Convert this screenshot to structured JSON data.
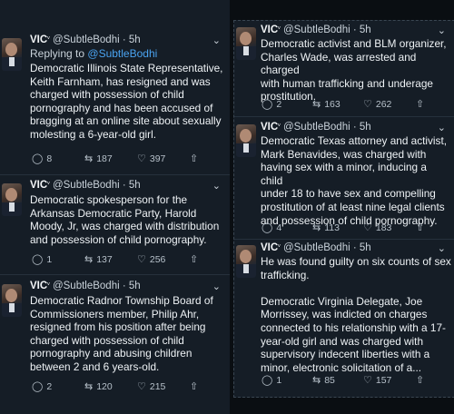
{
  "common": {
    "display_name": "VIC",
    "verified_mark": "ᵛ",
    "handle": "@SubtleBodhi",
    "time": "5h",
    "chevron": "⌄",
    "icons": {
      "reply": "◯",
      "retweet": "⇆",
      "like": "♡",
      "share": "⇧"
    }
  },
  "left_tweets": [
    {
      "reply_to_prefix": "Replying to",
      "reply_to_handle": "@SubtleBodhi",
      "text": "Democratic Illinois State Representative,\nKeith Farnham, has resigned and was\ncharged with possession of child\npornography and has been accused of\nbragging at an online site about sexually\nmolesting a 6-year-old girl.",
      "replies": "8",
      "retweets": "187",
      "likes": "397"
    },
    {
      "text": "Democratic spokesperson for the\nArkansas Democratic Party, Harold\nMoody, Jr, was charged with distribution\nand possession of child pornography.",
      "replies": "1",
      "retweets": "137",
      "likes": "256"
    },
    {
      "text": "Democratic Radnor Township Board of\nCommissioners member, Philip Ahr,\nresigned from his position after being\ncharged with possession of child\npornography and abusing children\nbetween 2 and 6 years-old.",
      "replies": "2",
      "retweets": "120",
      "likes": "215"
    }
  ],
  "right_tweets": [
    {
      "text": "Democratic activist and BLM organizer,\nCharles Wade, was arrested and charged\nwith human trafficking and underage\nprostitution.",
      "replies": "2",
      "retweets": "163",
      "likes": "262"
    },
    {
      "text": "Democratic Texas attorney and activist,\nMark Benavides, was charged with\nhaving sex with a minor, inducing a child\nunder 18 to have sex and compelling\nprostitution of at least nine legal clients\nand possession of child pornography.",
      "replies": "4",
      "retweets": "113",
      "likes": "183"
    },
    {
      "text": "He was found guilty on six counts of sex\ntrafficking.\n\nDemocratic Virginia Delegate, Joe\nMorrissey, was indicted on charges\nconnected to his relationship with a 17-\nyear-old girl and was charged with\nsupervisory indecent liberties with a\nminor, electronic solicitation of a...",
      "replies": "1",
      "retweets": "85",
      "likes": "157"
    }
  ]
}
